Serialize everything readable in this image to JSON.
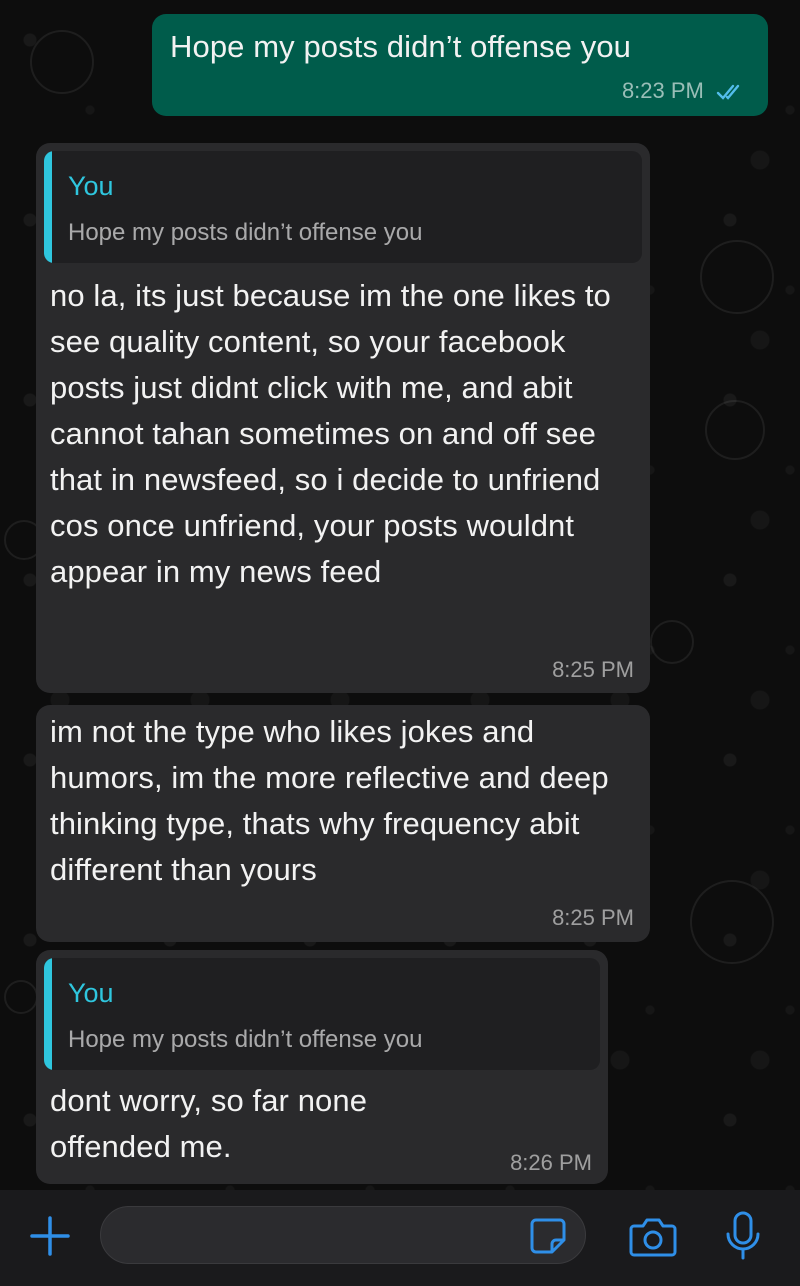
{
  "colors": {
    "outgoing_bubble": "#005c4b",
    "incoming_bubble": "#2a2a2c",
    "quote_accent": "#2fc6de",
    "icon_blue": "#2f8fe8",
    "read_ticks": "#53bdeb"
  },
  "messages": [
    {
      "direction": "outgoing",
      "text": "Hope my posts didn’t offense you",
      "time": "8:23 PM",
      "status_icon": "double-check-icon"
    },
    {
      "direction": "incoming",
      "quote_author": "You",
      "quote_text": "Hope my posts didn’t offense you",
      "text": "no la, its just because im the one likes to see quality content, so your facebook posts just didnt click with me, and abit cannot tahan sometimes on and off see that in newsfeed, so i decide to unfriend cos once unfriend, your posts wouldnt appear in my news feed",
      "time": "8:25 PM"
    },
    {
      "direction": "incoming",
      "text": "im not the type who likes jokes and humors, im the more reflective and deep thinking type, thats why frequency abit different than yours",
      "time": "8:25 PM"
    },
    {
      "direction": "incoming",
      "quote_author": "You",
      "quote_text": "Hope my posts didn’t offense you",
      "text": "dont worry, so far none offended me.",
      "time": "8:26 PM"
    }
  ],
  "composer": {
    "placeholder": "",
    "icons": [
      "plus-icon",
      "sticker-icon",
      "camera-icon",
      "microphone-icon"
    ]
  }
}
